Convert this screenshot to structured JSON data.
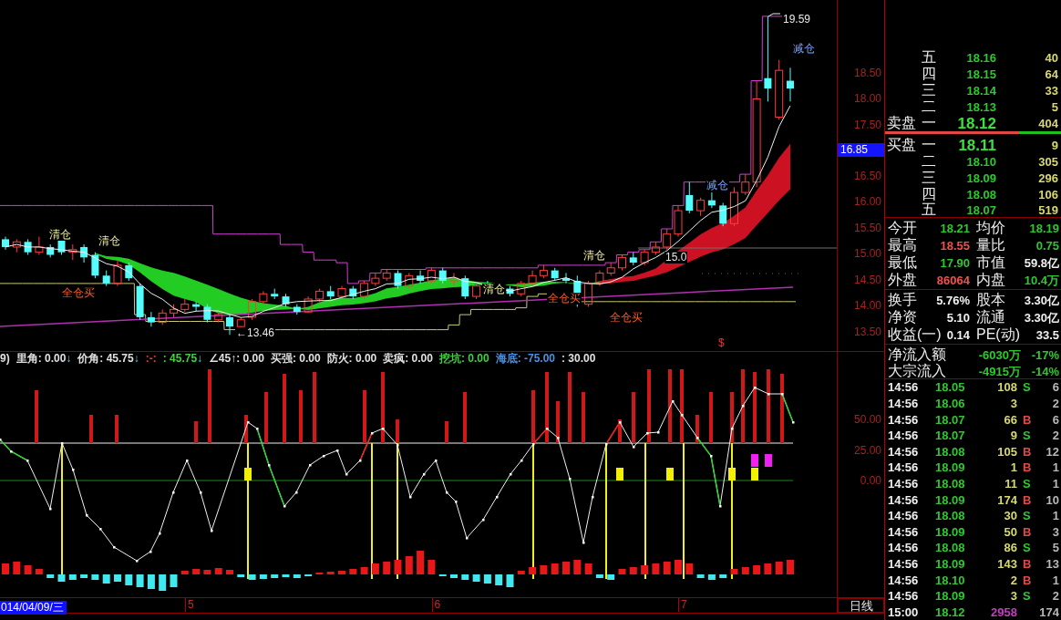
{
  "main_chart": {
    "annotations": [
      {
        "kind": "price",
        "text": "19.59"
      },
      {
        "kind": "reduce",
        "text": "减仓"
      },
      {
        "kind": "reduce",
        "text": "减仓"
      },
      {
        "kind": "exit",
        "text": "清仓"
      },
      {
        "kind": "exit",
        "text": "清仓"
      },
      {
        "kind": "exit",
        "text": "清仓"
      },
      {
        "kind": "price",
        "text": "15.0"
      },
      {
        "kind": "exit",
        "text": "清仓"
      },
      {
        "kind": "buy",
        "text": "全仓买"
      },
      {
        "kind": "buy",
        "text": "全仓买"
      },
      {
        "kind": "buy",
        "text": "全仓买"
      },
      {
        "kind": "price",
        "text": "←13.46"
      },
      {
        "kind": "flag",
        "text": "$"
      }
    ],
    "price_axis": [
      "18.50",
      "18.00",
      "17.50",
      "16.50",
      "16.00",
      "15.50",
      "15.00",
      "14.50",
      "14.00",
      "13.50"
    ],
    "current_price": "16.85"
  },
  "indicator": {
    "readings": [
      {
        "text": "9)",
        "color": "#e0e0e0"
      },
      {
        "text": "里角: 0.00",
        "arrow": "↓",
        "color": "#e0e0e0"
      },
      {
        "text": "价角: 45.75",
        "arrow": "↓",
        "color": "#e0e0e0"
      },
      {
        "text": ":-:",
        "color": "#ff3030"
      },
      {
        "text": ": 45.75",
        "arrow": "↓",
        "color": "#40d040"
      },
      {
        "text": "∠45↑: 0.00",
        "color": "#e0e0e0"
      },
      {
        "text": "买强: 0.00",
        "color": "#e0e0e0"
      },
      {
        "text": "防火: 0.00",
        "color": "#e0e0e0"
      },
      {
        "text": "卖疯: 0.00",
        "color": "#e0e0e0"
      },
      {
        "text": "挖坑: 0.00",
        "color": "#40d040"
      },
      {
        "text": "海底: -75.00",
        "color": "#4a90e0"
      },
      {
        "text": ": 30.00",
        "color": "#e0e0e0"
      }
    ],
    "axis": [
      "50.00",
      "25.00",
      "0.00"
    ]
  },
  "time_axis": {
    "cursor_date": "014/04/09/三",
    "months": [
      "5",
      "6",
      "7"
    ],
    "period": "日线"
  },
  "order_book": {
    "asks": [
      {
        "level": "五",
        "price": "18.16",
        "volume": "40",
        "best": false
      },
      {
        "level": "四",
        "price": "18.15",
        "volume": "64",
        "best": false
      },
      {
        "level": "三",
        "price": "18.14",
        "volume": "33",
        "best": false
      },
      {
        "level": "二",
        "price": "18.13",
        "volume": "5",
        "best": false
      },
      {
        "side": "卖盘",
        "level": "一",
        "price": "18.12",
        "volume": "404",
        "best": true
      }
    ],
    "ratio_bar": {
      "level": 0.76
    },
    "bids": [
      {
        "side": "买盘",
        "level": "一",
        "price": "18.11",
        "volume": "9",
        "best": true
      },
      {
        "level": "二",
        "price": "18.10",
        "volume": "305",
        "best": false
      },
      {
        "level": "三",
        "price": "18.09",
        "volume": "296",
        "best": false
      },
      {
        "level": "四",
        "price": "18.08",
        "volume": "106",
        "best": false
      },
      {
        "level": "五",
        "price": "18.07",
        "volume": "519",
        "best": false
      }
    ]
  },
  "quote_sections": [
    {
      "rows": [
        [
          {
            "label": "今开",
            "value": "18.21",
            "color": "#2ec82e"
          },
          {
            "label": "均价",
            "value": "18.19",
            "color": "#2ec82e"
          }
        ],
        [
          {
            "label": "最高",
            "value": "18.55",
            "color": "#f05050"
          },
          {
            "label": "量比",
            "value": "0.75",
            "color": "#2ec82e"
          }
        ],
        [
          {
            "label": "最低",
            "value": "17.90",
            "color": "#2ec82e"
          },
          {
            "label": "市值",
            "value": "59.8亿",
            "color": "#f0f0f0"
          }
        ],
        [
          {
            "label": "外盘",
            "value": "86064",
            "color": "#f05050"
          },
          {
            "label": "内盘",
            "value": "10.4万",
            "color": "#2ec82e"
          }
        ]
      ]
    },
    {
      "rows": [
        [
          {
            "label": "换手",
            "value": "5.76%",
            "color": "#f0f0f0"
          },
          {
            "label": "股本",
            "value": "3.30亿",
            "color": "#f0f0f0"
          }
        ],
        [
          {
            "label": "净资",
            "value": "5.10",
            "color": "#f0f0f0"
          },
          {
            "label": "流通",
            "value": "3.30亿",
            "color": "#f0f0f0"
          }
        ],
        [
          {
            "label": "收益(一)",
            "value": "0.14",
            "color": "#f0f0f0"
          },
          {
            "label": "PE(动)",
            "value": "33.5",
            "color": "#f0f0f0"
          }
        ]
      ]
    }
  ],
  "money_flow": [
    {
      "label": "净流入额",
      "amount": "-6030万",
      "percent": "-17%"
    },
    {
      "label": "大宗流入",
      "amount": "-4915万",
      "percent": "-14%"
    }
  ],
  "trades": [
    {
      "time": "14:56",
      "price": "18.05",
      "volume": "108",
      "side": "S",
      "count": "6",
      "kind": "sell"
    },
    {
      "time": "14:56",
      "price": "18.06",
      "volume": "3",
      "count": "2",
      "kind": "neutral"
    },
    {
      "time": "14:56",
      "price": "18.07",
      "volume": "66",
      "side": "B",
      "count": "6",
      "kind": "buy"
    },
    {
      "time": "14:56",
      "price": "18.07",
      "volume": "9",
      "side": "S",
      "count": "2",
      "kind": "sell"
    },
    {
      "time": "14:56",
      "price": "18.08",
      "volume": "105",
      "side": "B",
      "count": "12",
      "kind": "buy"
    },
    {
      "time": "14:56",
      "price": "18.09",
      "volume": "1",
      "side": "B",
      "count": "1",
      "kind": "buy"
    },
    {
      "time": "14:56",
      "price": "18.08",
      "volume": "11",
      "side": "S",
      "count": "1",
      "kind": "sell"
    },
    {
      "time": "14:56",
      "price": "18.09",
      "volume": "174",
      "side": "B",
      "count": "10",
      "kind": "buy"
    },
    {
      "time": "14:56",
      "price": "18.08",
      "volume": "30",
      "side": "S",
      "count": "1",
      "kind": "sell"
    },
    {
      "time": "14:56",
      "price": "18.09",
      "volume": "50",
      "side": "B",
      "count": "3",
      "kind": "buy"
    },
    {
      "time": "14:56",
      "price": "18.08",
      "volume": "86",
      "side": "S",
      "count": "5",
      "kind": "sell"
    },
    {
      "time": "14:56",
      "price": "18.09",
      "volume": "143",
      "side": "B",
      "count": "13",
      "kind": "buy"
    },
    {
      "time": "14:56",
      "price": "18.10",
      "volume": "2",
      "side": "B",
      "count": "1",
      "kind": "buy"
    },
    {
      "time": "14:56",
      "price": "18.09",
      "volume": "3",
      "side": "S",
      "count": "2",
      "kind": "sell"
    },
    {
      "time": "15:00",
      "price": "18.12",
      "volume": "2958",
      "count": "174",
      "kind": "auction"
    }
  ]
}
